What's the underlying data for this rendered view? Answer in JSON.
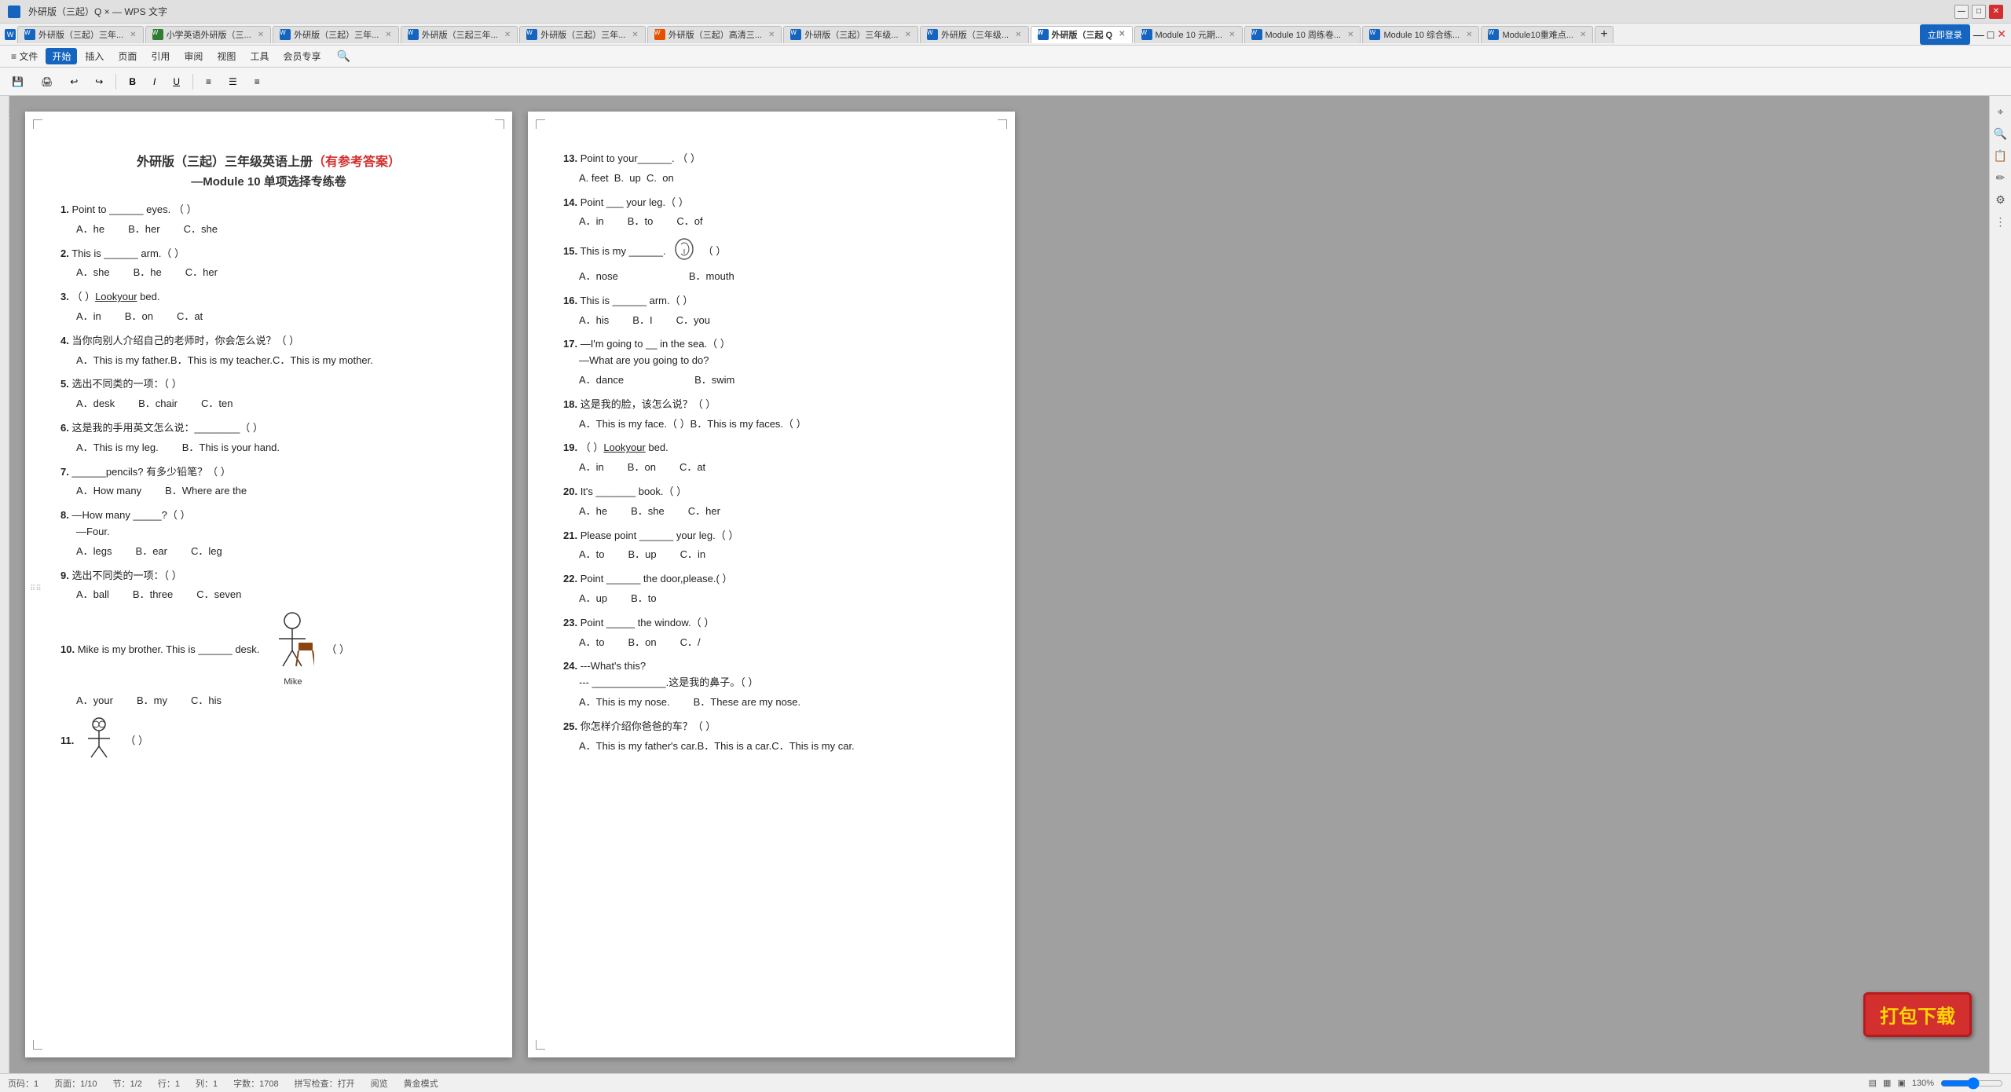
{
  "app": {
    "title": "外研版（三起）三年级英语上册 — Module 10 单项选择专练卷",
    "logo": "W"
  },
  "tabs": [
    {
      "label": "外研版（三起）三年...",
      "active": false,
      "color": "blue"
    },
    {
      "label": "小学英语外研版（三...",
      "active": false,
      "color": "blue"
    },
    {
      "label": "外研版（三起）三年...",
      "active": false,
      "color": "blue"
    },
    {
      "label": "外研版（三起三年...",
      "active": false,
      "color": "blue"
    },
    {
      "label": "外研版（三起）三年...",
      "active": false,
      "color": "blue"
    },
    {
      "label": "外研版（三起）高清三...",
      "active": false,
      "color": "blue"
    },
    {
      "label": "外研版（三起）三年级...",
      "active": false,
      "color": "blue"
    },
    {
      "label": "外研版（三年级...",
      "active": false,
      "color": "blue"
    },
    {
      "label": "外研版（三起 Q ×",
      "active": true,
      "color": "blue"
    },
    {
      "label": "Module 10 元期...",
      "active": false,
      "color": "blue"
    },
    {
      "label": "Module 10 周练卷...",
      "active": false,
      "color": "blue"
    },
    {
      "label": "Module 10 综合练...",
      "active": false,
      "color": "blue"
    },
    {
      "label": "Module10重难点...",
      "active": false,
      "color": "blue"
    }
  ],
  "menus": [
    "文件",
    "开始",
    "插入",
    "页面",
    "引用",
    "审阅",
    "视图",
    "工具",
    "会员专享"
  ],
  "active_menu": "开始",
  "page1": {
    "title": "外研版（三起）三年级英语上册",
    "title_red": "（有参考答案）",
    "subtitle": "—Module 10 单项选择专练卷",
    "questions": [
      {
        "num": "1.",
        "text": "Point to ______ eyes. （ ）",
        "options": [
          {
            "letter": "A.",
            "text": "he"
          },
          {
            "letter": "B.",
            "text": "her"
          },
          {
            "letter": "C.",
            "text": "she"
          }
        ]
      },
      {
        "num": "2.",
        "text": "This is ______ arm.（    ）",
        "options": [
          {
            "letter": "A.",
            "text": "she"
          },
          {
            "letter": "B.",
            "text": "he"
          },
          {
            "letter": "C.",
            "text": "her"
          }
        ]
      },
      {
        "num": "3.",
        "text": "（ ）Lookyour bed.",
        "options": [
          {
            "letter": "A.",
            "text": "in"
          },
          {
            "letter": "B.",
            "text": "on"
          },
          {
            "letter": "C.",
            "text": "at"
          }
        ]
      },
      {
        "num": "4.",
        "text": "当你向别人介绍自己的老师时，你会怎么说？（  ）",
        "options_text": "A．This is my father.B．This is my teacher.C．This is my mother."
      },
      {
        "num": "5.",
        "text": "选出不同类的一项：（  ）",
        "options": [
          {
            "letter": "A.",
            "text": "desk"
          },
          {
            "letter": "B.",
            "text": "chair"
          },
          {
            "letter": "C.",
            "text": "ten"
          }
        ]
      },
      {
        "num": "6.",
        "text": "这是我的手用英文怎么说：________（    ）",
        "options": [
          {
            "letter": "A.",
            "text": "This is my leg."
          },
          {
            "letter": "B.",
            "text": "This is your hand."
          }
        ]
      },
      {
        "num": "7.",
        "text": "______pencils? 有多少铅笔？（  ）",
        "options": [
          {
            "letter": "A.",
            "text": "How many"
          },
          {
            "letter": "B.",
            "text": "Where are the"
          }
        ]
      },
      {
        "num": "8.",
        "text": "—How many _____?（  ）",
        "sub_text": "—Four.",
        "options": [
          {
            "letter": "A.",
            "text": "legs"
          },
          {
            "letter": "B.",
            "text": "ear"
          },
          {
            "letter": "C.",
            "text": "leg"
          }
        ]
      },
      {
        "num": "9.",
        "text": "选出不同类的一项：（  ）",
        "options": [
          {
            "letter": "A.",
            "text": "ball"
          },
          {
            "letter": "B.",
            "text": "three"
          },
          {
            "letter": "C.",
            "text": "seven"
          }
        ]
      },
      {
        "num": "10.",
        "text": "Mike is my brother. This is ______ desk.",
        "has_figure": true,
        "figure_label": "Mike",
        "options": [
          {
            "letter": "A.",
            "text": "your"
          },
          {
            "letter": "B.",
            "text": "my"
          },
          {
            "letter": "C.",
            "text": "his"
          }
        ]
      },
      {
        "num": "11.",
        "text": "（    ）",
        "has_figure2": true
      }
    ]
  },
  "page2": {
    "questions": [
      {
        "num": "13.",
        "text": "Point to your______. （  ）",
        "options_text": "A. feetB.  upC.  on"
      },
      {
        "num": "14.",
        "text": "Point ___ your leg.（  ）",
        "options": [
          {
            "letter": "A.",
            "text": "in"
          },
          {
            "letter": "B.",
            "text": "to"
          },
          {
            "letter": "C.",
            "text": "of"
          }
        ]
      },
      {
        "num": "15.",
        "text": "This is my ______.（  ）",
        "has_icon": true,
        "options": [
          {
            "letter": "A.",
            "text": "nose"
          },
          {
            "letter": "B.",
            "text": "mouth"
          }
        ]
      },
      {
        "num": "16.",
        "text": "This is ______ arm.（  ）",
        "options": [
          {
            "letter": "A.",
            "text": "his"
          },
          {
            "letter": "B.",
            "text": "I"
          },
          {
            "letter": "C.",
            "text": "you"
          }
        ]
      },
      {
        "num": "17.",
        "text": "—I'm going to __ in the sea.（    ）",
        "sub_text": "—What are you going to do?",
        "options": [
          {
            "letter": "A.",
            "text": "dance"
          },
          {
            "letter": "B.",
            "text": "swim"
          }
        ]
      },
      {
        "num": "18.",
        "text": "这是我的脸，该怎么说？（    ）",
        "options": [
          {
            "letter": "A.",
            "text": "This is my face.（    ）"
          },
          {
            "letter": "B.",
            "text": "This is my faces.（  ）"
          }
        ]
      },
      {
        "num": "19.",
        "text": "（ ）Lookyour bed.",
        "options": [
          {
            "letter": "A.",
            "text": "in"
          },
          {
            "letter": "B.",
            "text": "on"
          },
          {
            "letter": "C.",
            "text": "at"
          }
        ]
      },
      {
        "num": "20.",
        "text": "It's _______ book.（  ）",
        "options": [
          {
            "letter": "A.",
            "text": "he"
          },
          {
            "letter": "B.",
            "text": "she"
          },
          {
            "letter": "C.",
            "text": "her"
          }
        ]
      },
      {
        "num": "21.",
        "text": "Please point ______ your leg.（  ）",
        "options": [
          {
            "letter": "A.",
            "text": "to"
          },
          {
            "letter": "B.",
            "text": "up"
          },
          {
            "letter": "C.",
            "text": "in"
          }
        ]
      },
      {
        "num": "22.",
        "text": "Point ______ the door,please.(        ）",
        "options": [
          {
            "letter": "A.",
            "text": "up"
          },
          {
            "letter": "B.",
            "text": "to"
          }
        ]
      },
      {
        "num": "23.",
        "text": "Point _____ the window.（  ）",
        "options": [
          {
            "letter": "A.",
            "text": "to"
          },
          {
            "letter": "B.",
            "text": "on"
          },
          {
            "letter": "C.",
            "text": "/"
          }
        ]
      },
      {
        "num": "24.",
        "text": "---What's this?",
        "sub_text": "--- _____________.这是我的鼻子。（  ）",
        "options": [
          {
            "letter": "A.",
            "text": "This is my nose."
          },
          {
            "letter": "B.",
            "text": "These are my nose."
          }
        ]
      },
      {
        "num": "25.",
        "text": "你怎样介绍你爸爸的车？（  ）",
        "options_text": "A．This is my father's car.B．This is a car.C．This is my car."
      }
    ]
  },
  "status_bar": {
    "page": "页码：1",
    "pages": "页面：1/10",
    "section": "节：1/2",
    "position": "行：1",
    "col": "列：1",
    "words": "字数：1708",
    "spell_check": "拼写检查：打开",
    "mode": "阅览",
    "layout": "黄金模式"
  },
  "zoom": "130%",
  "download_badge": "打包下载"
}
